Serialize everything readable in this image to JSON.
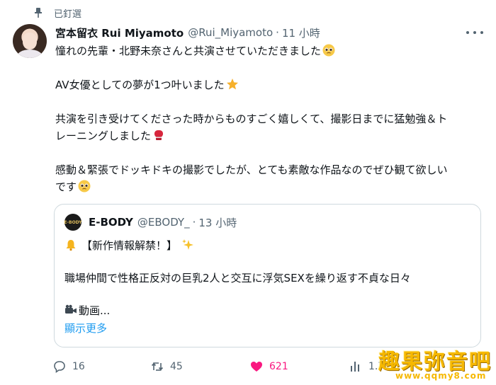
{
  "pinned": {
    "label": "已釘選"
  },
  "author": {
    "name": "宮本留衣 Rui Miyamoto",
    "handle": "@Rui_Miyamoto",
    "separator": "·",
    "time": "11 小時"
  },
  "tweet": {
    "line1": "憧れの先輩・北野未奈さんと共演させていただきました",
    "line2": "AV女優としての夢が1つ叶いました",
    "line3": "共演を引き受けてくださった時からものすごく嬉しくて、撮影日までに猛勉強＆ト",
    "line4": "レーニングしました",
    "line5": "感動＆緊張でドッキドキの撮影でしたが、とても素敵な作品なのでぜひ観て欲しい",
    "line6": "です"
  },
  "quote": {
    "logo_text": "E-BODY",
    "name": "E-BODY",
    "handle": "@EBODY_",
    "separator": "·",
    "time": "13 小時",
    "line1": "【新作情報解禁！】",
    "line2": "職場仲間で性格正反対の巨乳2人と交互に浮気SEXを繰り返す不貞な日々",
    "line3": "動画...",
    "show_more": "顯示更多"
  },
  "actions": {
    "replies": "16",
    "retweets": "45",
    "likes": "621",
    "views": "1.7"
  },
  "colors": {
    "accent": "#1d9bf0",
    "like": "#f91880",
    "muted": "#536471",
    "watermark": "#f6b800"
  },
  "watermark": {
    "title": "趣果弥音吧",
    "url": "www.qqmy8.com"
  },
  "icons": [
    "pin-icon",
    "more-icon",
    "pleading-face-icon",
    "star-icon",
    "boxing-glove-icon",
    "bell-icon",
    "sparkles-icon",
    "video-camera-icon",
    "reply-icon",
    "retweet-icon",
    "heart-icon",
    "views-icon"
  ]
}
